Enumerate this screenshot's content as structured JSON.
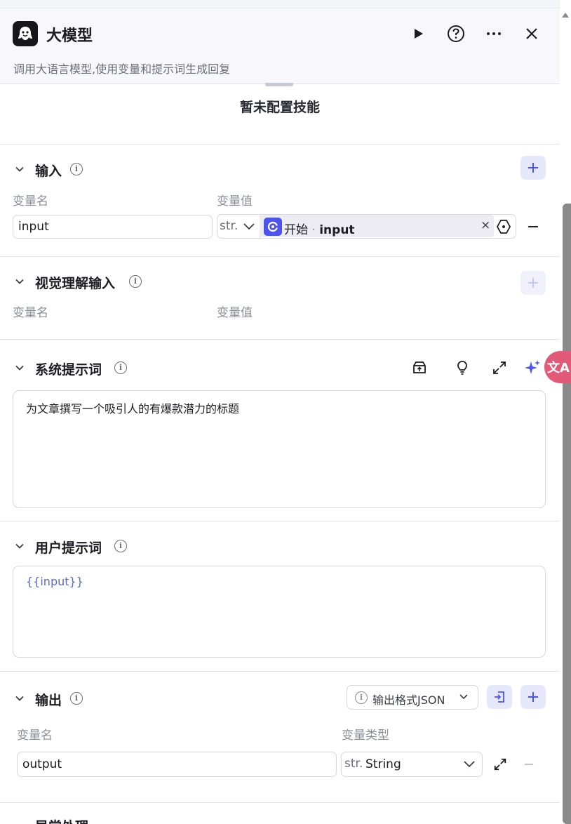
{
  "header": {
    "title": "大模型",
    "description": "调用大语言模型,使用变量和提示词生成回复"
  },
  "skills": {
    "empty_text": "暂未配置技能"
  },
  "input_section": {
    "title": "输入",
    "col_name": "变量名",
    "col_value": "变量值",
    "row": {
      "name": "input",
      "type": "str.",
      "ref_node": "开始",
      "ref_sep": "·",
      "ref_var": "input",
      "clear": "×"
    }
  },
  "vision_section": {
    "title": "视觉理解输入",
    "col_name": "变量名",
    "col_value": "变量值"
  },
  "system_prompt": {
    "title": "系统提示词",
    "text": "为文章撰写一个吸引人的有爆款潜力的标题"
  },
  "user_prompt": {
    "title": "用户提示词",
    "text": "{{input}}"
  },
  "output_section": {
    "title": "输出",
    "format_label": "输出格式JSON",
    "col_name": "变量名",
    "col_type": "变量类型",
    "row": {
      "name": "output",
      "type_prefix": "str.",
      "type": "String"
    }
  },
  "exception_section": {
    "title": "异常处理"
  },
  "translate_widget": {
    "label": "文A"
  },
  "colors": {
    "accent": "#4c54f0",
    "accent_bg": "#e6e7fb",
    "border": "#d6d8e0",
    "muted": "#8b8d98"
  },
  "icons": [
    "logo-icon",
    "run-icon",
    "help-icon",
    "more-icon",
    "close-icon",
    "chevron-down-icon",
    "info-icon",
    "plus-icon",
    "minus-icon",
    "variable-icon",
    "library-icon",
    "lightbulb-icon",
    "expand-icon",
    "sparkle-icon",
    "import-icon"
  ]
}
